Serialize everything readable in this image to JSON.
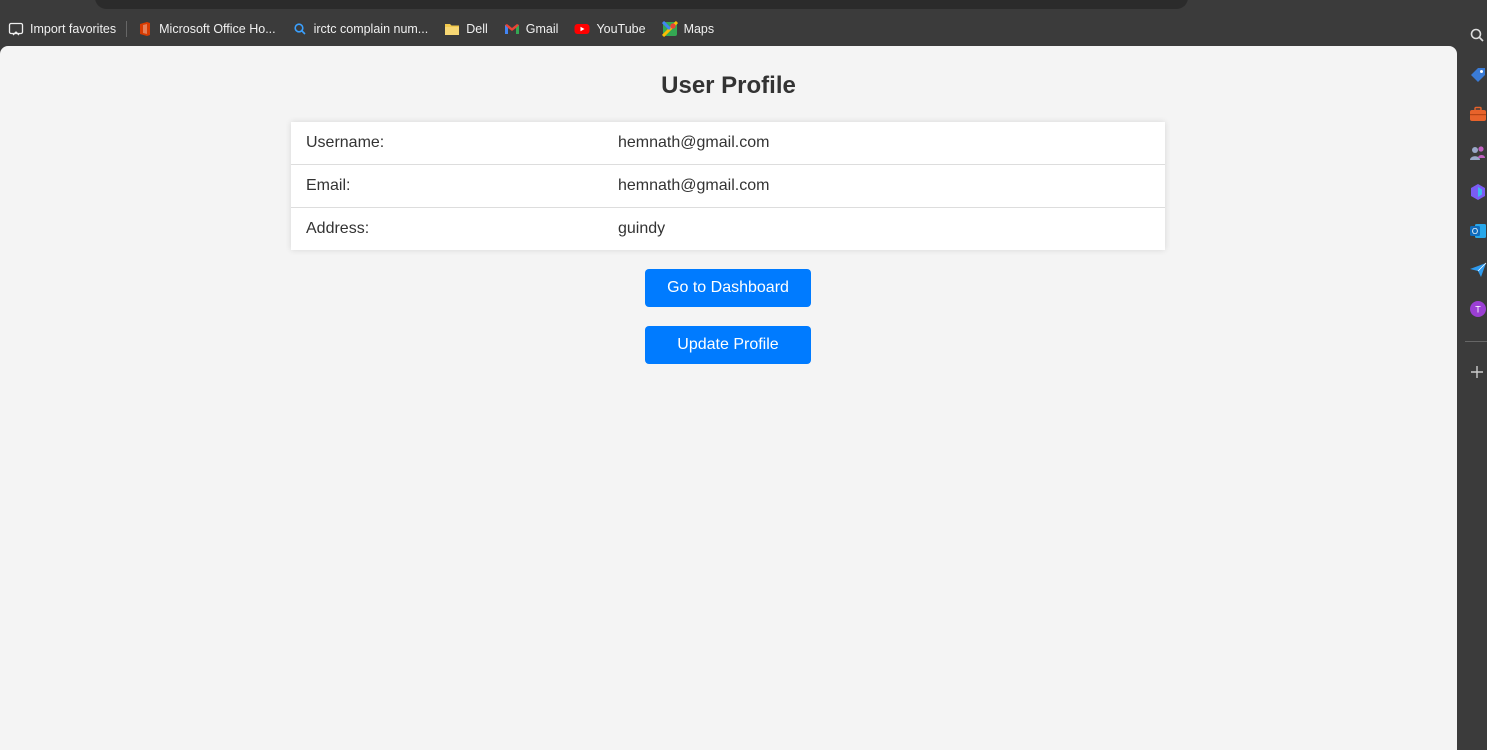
{
  "favorites": [
    {
      "label": "Import favorites",
      "icon": "import-favorites-icon"
    },
    {
      "label": "Microsoft Office Ho...",
      "icon": "office-icon"
    },
    {
      "label": "irctc complain num...",
      "icon": "search-icon"
    },
    {
      "label": "Dell",
      "icon": "folder-icon"
    },
    {
      "label": "Gmail",
      "icon": "gmail-icon"
    },
    {
      "label": "YouTube",
      "icon": "youtube-icon"
    },
    {
      "label": "Maps",
      "icon": "maps-icon"
    }
  ],
  "page": {
    "title": "User Profile",
    "rows": [
      {
        "label": "Username:",
        "value": "hemnath@gmail.com"
      },
      {
        "label": "Email:",
        "value": "hemnath@gmail.com"
      },
      {
        "label": "Address:",
        "value": "guindy"
      }
    ],
    "dashboard_button": "Go to Dashboard",
    "update_button": "Update Profile"
  },
  "sidebar": {
    "icons": [
      "search-icon",
      "tag-icon",
      "briefcase-icon",
      "people-icon",
      "copilot-icon",
      "outlook-icon",
      "send-icon",
      "profile-t-icon",
      "add-icon"
    ],
    "profile_letter": "T"
  },
  "colors": {
    "accent": "#007bff",
    "page_bg": "#f4f4f4",
    "chrome_bg": "#3b3b3b"
  }
}
